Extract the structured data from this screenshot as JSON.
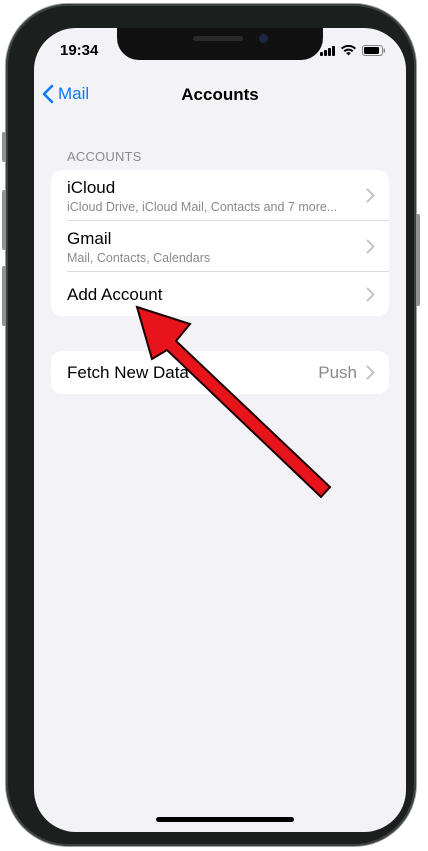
{
  "status_bar": {
    "time": "19:34"
  },
  "nav": {
    "back_label": "Mail",
    "title": "Accounts"
  },
  "accounts_section": {
    "header": "ACCOUNTS",
    "items": [
      {
        "title": "iCloud",
        "subtitle": "iCloud Drive, iCloud Mail, Contacts and 7 more..."
      },
      {
        "title": "Gmail",
        "subtitle": "Mail, Contacts, Calendars"
      },
      {
        "title": "Add Account",
        "subtitle": ""
      }
    ]
  },
  "fetch_section": {
    "title": "Fetch New Data",
    "value": "Push"
  },
  "colors": {
    "accent": "#0a7aff",
    "background": "#f2f2f7",
    "annotation_arrow": "#e8141b"
  },
  "icons": [
    "chevron-left-icon",
    "chevron-right-icon",
    "signal-icon",
    "wifi-icon",
    "battery-icon",
    "annotation-arrow"
  ]
}
